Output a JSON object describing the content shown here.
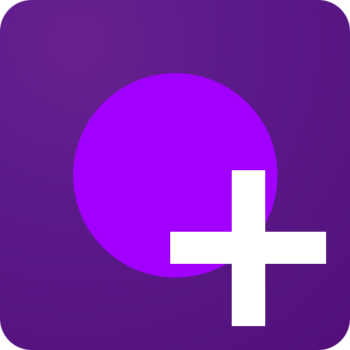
{
  "app_icon": {
    "icon": "plus-icon",
    "colors": {
      "background_dark": "#511079",
      "background_light": "#68228f",
      "circle": "#a100ff",
      "symbol": "#ffffff"
    }
  }
}
